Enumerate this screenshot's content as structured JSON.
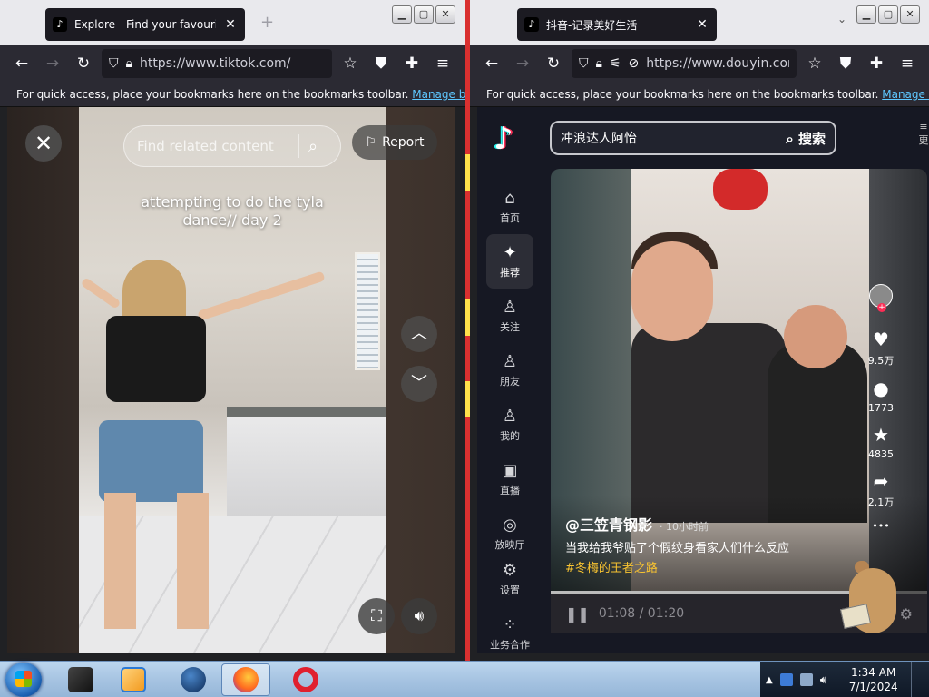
{
  "left_window": {
    "tab_title": "Explore - Find your favourite videos on TikTok",
    "tab_favicon": "tiktok-favicon",
    "url": "https://www.tiktok.com/",
    "bookmarks_text": "For quick access, place your bookmarks here on the bookmarks toolbar.",
    "bookmarks_link": "Manage bookmarks",
    "tiktok": {
      "search_placeholder": "Find related content",
      "report_label": "Report",
      "caption_line1": "attempting to do the tyla",
      "caption_line2": "dance// day 2"
    }
  },
  "right_window": {
    "tab_title": "抖音-记录美好生活",
    "tab_favicon": "douyin-favicon",
    "url": "https://www.douyin.com/",
    "bookmarks_text": "For quick access, place your bookmarks here on the bookmarks toolbar.",
    "bookmarks_link": "Manage bookmarks",
    "douyin": {
      "search_value": "冲浪达人阿怡",
      "search_button": "搜索",
      "more_label": "更",
      "nav": [
        {
          "label": "首页",
          "icon": "⌂"
        },
        {
          "label": "推荐",
          "icon": "✦"
        },
        {
          "label": "关注",
          "icon": "♙"
        },
        {
          "label": "朋友",
          "icon": "♙"
        },
        {
          "label": "我的",
          "icon": "♙"
        },
        {
          "label": "直播",
          "icon": "▣"
        },
        {
          "label": "放映厅",
          "icon": "◎"
        },
        {
          "label": "设置",
          "icon": "⚙"
        },
        {
          "label": "业务合作",
          "icon": "⁘"
        }
      ],
      "actions": [
        {
          "icon": "♥",
          "count": "9.5万"
        },
        {
          "icon": "●",
          "count": "1773"
        },
        {
          "icon": "★",
          "count": "4835"
        },
        {
          "icon": "➦",
          "count": "2.1万"
        }
      ],
      "more_dots": "•••",
      "author": "@三笠青钢影",
      "time_ago": "· 10小时前",
      "description": "当我给我爷贴了个假纹身看家人们什么反应",
      "hashtag": "#冬梅的王者之路",
      "current_time": "01:08",
      "total_time": "01:20",
      "progress": 0.85
    }
  },
  "taskbar": {
    "time": "1:34 AM",
    "date": "7/1/2024"
  },
  "colors": {
    "firefox_dark": "#2b2a33",
    "link_blue": "#5ec8ff",
    "douyin_bg": "#161823",
    "hashtag_yellow": "#f8c331",
    "divider_red": "#d93030"
  }
}
